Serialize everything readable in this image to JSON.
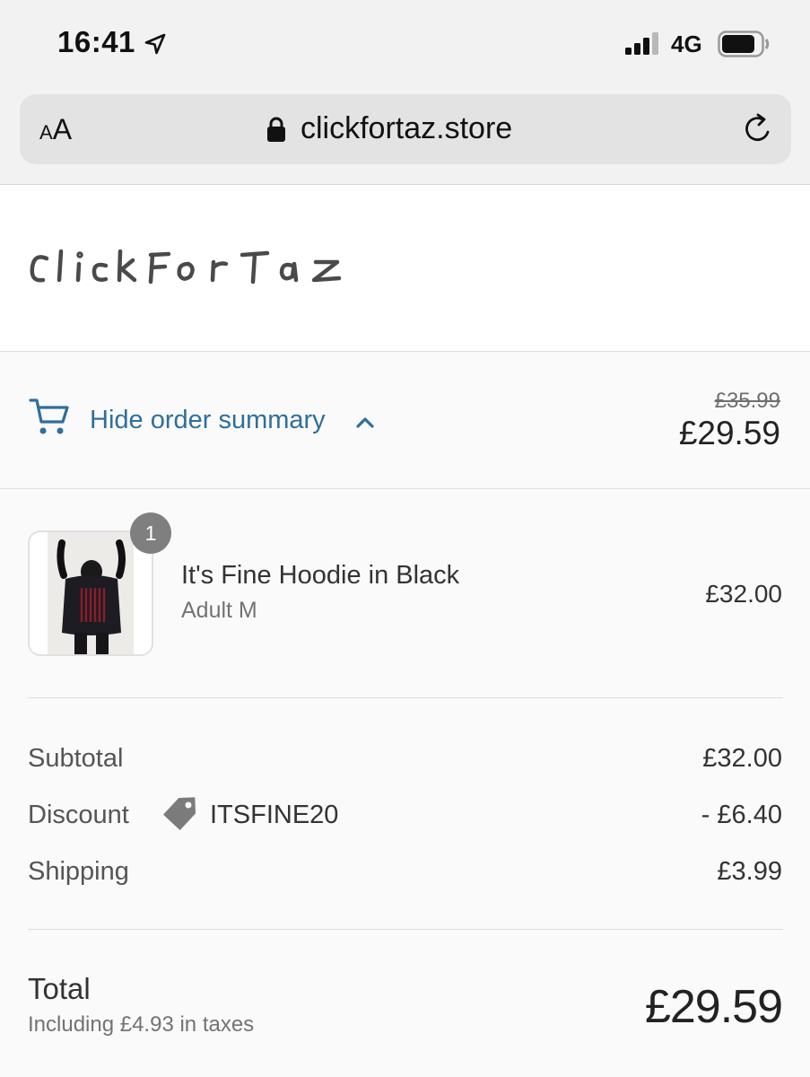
{
  "status_bar": {
    "time": "16:41",
    "network": "4G"
  },
  "browser": {
    "text_size_label": "AA",
    "url": "clickfortaz.store"
  },
  "store": {
    "logo_text": "ClickForTaz"
  },
  "order_summary": {
    "toggle_label": "Hide order summary",
    "original_price": "£35.99",
    "price": "£29.59"
  },
  "line_items": [
    {
      "quantity": "1",
      "name": "It's Fine Hoodie in Black",
      "variant": "Adult M",
      "price": "£32.00"
    }
  ],
  "totals": {
    "subtotal_label": "Subtotal",
    "subtotal_value": "£32.00",
    "discount_label": "Discount",
    "discount_code": "ITSFINE20",
    "discount_value": "- £6.40",
    "shipping_label": "Shipping",
    "shipping_value": "£3.99",
    "total_label": "Total",
    "taxes_note": "Including £4.93 in taxes",
    "total_value": "£29.59"
  },
  "colors": {
    "link": "#2f6f9a",
    "badge": "#7f7f7f",
    "divider": "#dcdcdc"
  },
  "icons": [
    "location-arrow-icon",
    "signal-icon",
    "battery-icon",
    "lock-icon",
    "reload-icon",
    "cart-icon",
    "chevron-up-icon",
    "tag-icon"
  ]
}
